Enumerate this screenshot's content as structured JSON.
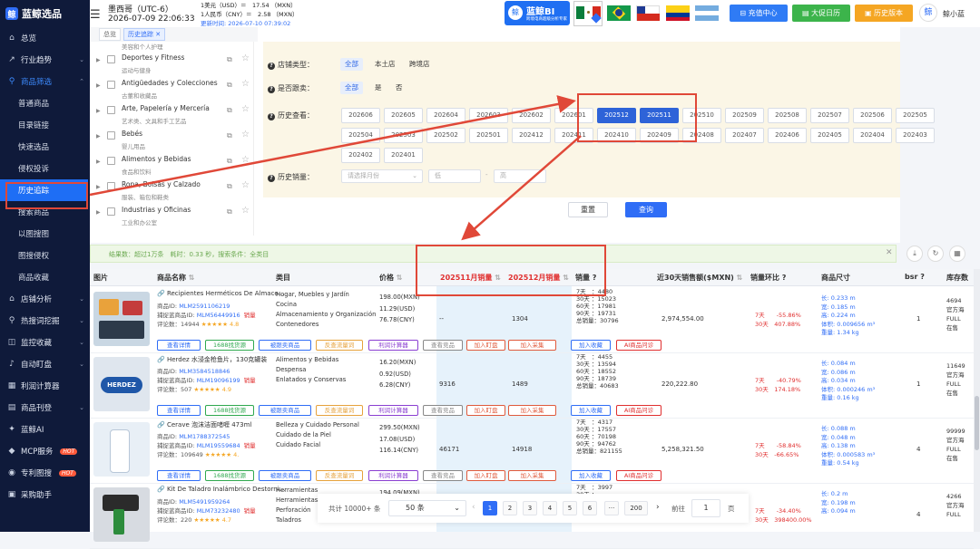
{
  "app": {
    "logo": "蓝鲸选品"
  },
  "sidebar": {
    "items": [
      {
        "label": "总览",
        "icon": "home-icon"
      },
      {
        "label": "行业趋势",
        "icon": "trend-icon"
      },
      {
        "label": "商品筛选",
        "icon": "filter-icon"
      },
      {
        "label": "普通商品"
      },
      {
        "label": "目录链接"
      },
      {
        "label": "快速选品"
      },
      {
        "label": "侵权投诉"
      },
      {
        "label": "历史追踪"
      },
      {
        "label": "搜索商品"
      },
      {
        "label": "以图搜图"
      },
      {
        "label": "图搜侵权"
      },
      {
        "label": "商品收藏"
      },
      {
        "label": "店铺分析",
        "icon": "store-icon"
      },
      {
        "label": "热搜词挖掘",
        "icon": "search-icon"
      },
      {
        "label": "监控收藏",
        "icon": "monitor-icon"
      },
      {
        "label": "自动盯盘",
        "icon": "bell-icon"
      },
      {
        "label": "利润计算器",
        "icon": "calculator-icon"
      },
      {
        "label": "商品刊登",
        "icon": "publish-icon"
      },
      {
        "label": "蓝鲸AI",
        "icon": "ai-icon"
      },
      {
        "label": "MCP服务",
        "icon": "mcp-icon",
        "badge": "HOT"
      },
      {
        "label": "专利图搜",
        "icon": "patent-icon",
        "badge": "HOT"
      },
      {
        "label": "采购助手",
        "icon": "purchase-icon"
      }
    ]
  },
  "header": {
    "region": "墨西哥（UTC-6）",
    "datetime": "2026-07-09 22:06:33",
    "rate_usd": "1美元（USD）＝　17.54 （MXN）",
    "rate_cny": "1人民币（CNY）＝　2.58 （MXN）",
    "updated": "更新时间: 2026-07-10 07:39:02",
    "bi_title": "蓝鲸BI",
    "bi_sub": "跨境电商超级分析专家",
    "recharge": "充值中心",
    "promo": "大促日历",
    "history_version": "历史版本",
    "username": "鲸小蓝"
  },
  "tabs": [
    {
      "label": "总览"
    },
    {
      "label": "历史追踪"
    }
  ],
  "categories": [
    {
      "en": "",
      "zh": "美容和个人护理"
    },
    {
      "en": "Deportes y Fitness",
      "zh": "运动与健身"
    },
    {
      "en": "Antigüedades y Colecciones",
      "zh": "古董和收藏品"
    },
    {
      "en": "Arte, Papelería y Mercería",
      "zh": "艺术类、文具和手工艺品"
    },
    {
      "en": "Bebés",
      "zh": "婴儿用品"
    },
    {
      "en": "Alimentos y Bebidas",
      "zh": "食品和饮料"
    },
    {
      "en": "Ropa, Bolsas y Calzado",
      "zh": "服装、箱包和鞋类"
    },
    {
      "en": "Industrias y Oficinas",
      "zh": "工业和办公室"
    }
  ],
  "filters": {
    "store_type": {
      "label": "店铺类型：",
      "options": [
        "全部",
        "本土店",
        "跨境店"
      ],
      "selected": "全部"
    },
    "followed": {
      "label": "是否跟卖：",
      "options": [
        "全部",
        "是",
        "否"
      ],
      "selected": "全部"
    },
    "history": {
      "label": "历史查看：",
      "months": [
        "202606",
        "202605",
        "202604",
        "202603",
        "202602",
        "202601",
        "202512",
        "202511",
        "202510",
        "202509",
        "202508",
        "202507",
        "202506",
        "202505",
        "202504",
        "202503",
        "202502",
        "202501",
        "202412",
        "202411",
        "202410",
        "202409",
        "202408",
        "202407",
        "202406",
        "202405",
        "202404",
        "202403",
        "202402",
        "202401"
      ],
      "selected": [
        "202512",
        "202511"
      ]
    },
    "history_sales": {
      "label": "历史销量：",
      "month_placeholder": "请选择月份",
      "low": "低",
      "high": "高",
      "sep": "-"
    },
    "reset": "重置",
    "query": "查询"
  },
  "result_bar": {
    "text": "结果数：超过1万条　耗时：0.33 秒，搜索条件：全类目"
  },
  "table": {
    "headers": {
      "img": "图片",
      "name": "商品名称",
      "cat": "类目",
      "price": "价格",
      "m1": "202511月销量",
      "m2": "202512月销量",
      "sales": "销量",
      "gmv": "近30天销售额($MXN)",
      "ring": "销量环比",
      "size": "商品尺寸",
      "bsr": "bsr",
      "stock": "库存数"
    },
    "rows": [
      {
        "name": "Recipientes Herméticos De Almace...",
        "id": "MLM2591106219",
        "cat_id": "MLM56449916",
        "tag": "销量",
        "reviews": "14944",
        "score": "4.8",
        "category": "Hogar, Muebles y Jardín\nCocina\nAlmacenamiento y Organización\nContenedores",
        "price": "198.00(MXN)\n11.29(USD)\n76.78(CNY)",
        "m1": "--",
        "m2": "1304",
        "sales": "7天　：4480\n30天 ：15023\n60天 ：17981\n90天 ：19731\n总销量：30796",
        "gmv": "2,974,554.00",
        "ring": "7天　　-55.86%\n30天　407.88%",
        "dims": "长: 0.233 m\n宽: 0.185 m\n高: 0.224 m\n体积: 0.009656 m³\n重量: 1.34 kg",
        "bsr": "1",
        "stock": "4694\n官方海\nFULL\n在售"
      },
      {
        "name": "Herdez 水浸金枪鱼片，130克罐装",
        "id": "MLM3584518846",
        "cat_id": "MLM19096199",
        "tag": "销量",
        "reviews": "507",
        "score": "4.9",
        "category": "Alimentos y Bebidas\nDespensa\nEnlatados y Conservas",
        "price": "16.20(MXN)\n0.92(USD)\n6.28(CNY)",
        "m1": "9316",
        "m2": "1489",
        "sales": "7天　：4455\n30天 ：13594\n60天 ：18552\n90天 ：18739\n总销量：40683",
        "gmv": "220,222.80",
        "ring": "7天　　-40.79%\n30天　174.18%",
        "dims": "长: 0.084 m\n宽: 0.086 m\n高: 0.034 m\n体积: 0.000246 m³\n重量: 0.16 kg",
        "bsr": "1",
        "stock": "11649\n官方海\nFULL\n在售"
      },
      {
        "name": "Cerave 泡沫洁面啫喱 473ml",
        "id": "MLM1788372545",
        "cat_id": "MLM19559684",
        "tag": "销量",
        "reviews": "109649",
        "score": "4.",
        "category": "Belleza y Cuidado Personal\nCuidado de la Piel\nCuidado Facial",
        "price": "299.50(MXN)\n17.08(USD)\n116.14(CNY)",
        "m1": "46171",
        "m2": "14918",
        "sales": "7天　：4317\n30天 ：17557\n60天 ：70198\n90天 ：94762\n总销量：821155",
        "gmv": "5,258,321.50",
        "ring": "7天　　-58.84%\n30天　-66.65%",
        "dims": "长: 0.088 m\n宽: 0.048 m\n高: 0.138 m\n体积: 0.000583 m³\n重量: 0.54 kg",
        "bsr": "4",
        "stock": "99999\n官方海\nFULL\n在售"
      },
      {
        "name": "Kit De Taladro Inalámbrico Destorni...",
        "id": "MLM5491959264",
        "cat_id": "MLM73232480",
        "tag": "销量",
        "reviews": "220",
        "score": "4.7",
        "category": "Herramientas\nHerramientas El\nPerforación\nTaladros",
        "price": "194.09(MXN)",
        "m1": "",
        "m2": "",
        "sales": "7天　：3997\n30天 ：\n60天 ：",
        "gmv": "",
        "ring": "7天　　-34.40%\n30天　398400.00%",
        "dims": "长: 0.2 m\n宽: 0.198 m\n高: 0.094 m",
        "bsr": "4",
        "stock": "4266\n官方海\nFULL"
      }
    ],
    "labels": {
      "product_id": "商品ID: ",
      "cat_id": "捕捉蓝商品ID: ",
      "reviews": "评论数："
    }
  },
  "actions": [
    {
      "label": "查看详情",
      "color": "#2f6df6"
    },
    {
      "label": "1688找货源",
      "color": "#2fa84f"
    },
    {
      "label": "被跟卖商品",
      "color": "#2f6df6"
    },
    {
      "label": "反查流量词",
      "color": "#e6a23c"
    },
    {
      "label": "利润计算器",
      "color": "#8a3fd1"
    },
    {
      "label": "查看竞品",
      "color": "#888888"
    },
    {
      "label": "加入盯盘",
      "color": "#e05a3c"
    },
    {
      "label": "加入采集",
      "color": "#e05a3c"
    },
    {
      "label": "加入收藏",
      "color": "#2f6df6"
    },
    {
      "label": "AI商品问诊",
      "color": "#e02f2f"
    }
  ],
  "pager": {
    "total": "共计 10000+ 条",
    "size": "50 条",
    "pages": [
      "1",
      "2",
      "3",
      "4",
      "5",
      "6",
      "···",
      "200"
    ],
    "goto": "前往",
    "goto_value": "1",
    "page_unit": "页"
  }
}
